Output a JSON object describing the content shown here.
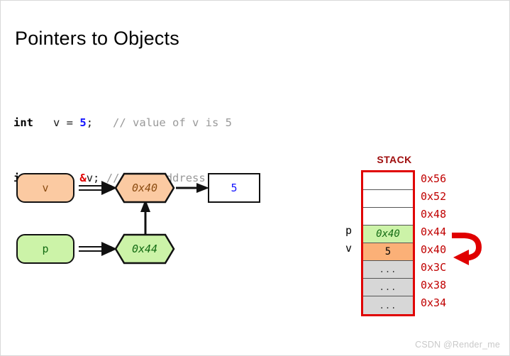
{
  "slide": {
    "title": "Pointers to Objects"
  },
  "code": {
    "lines": [
      {
        "keyword": "int",
        "star": "",
        "gap": "  ",
        "declaration": " v = ",
        "number": "5",
        "terminator": ";",
        "spacing": "   ",
        "comment": "// value of v is 5"
      },
      {
        "keyword": "int",
        "star": "*",
        "gap": " ",
        "declaration": " p = ",
        "number": "",
        "ampersand": "&",
        "target": "v",
        "terminator": ";",
        "spacing": " ",
        "comment": "// take address of v"
      }
    ]
  },
  "diagram": {
    "var_v_label": "v",
    "var_p_label": "p",
    "addr_v_label": "0x40",
    "addr_p_label": "0x44",
    "value_label": "5",
    "colors": {
      "orange_fill": "#fbcaa2",
      "orange_text": "#8a4b10",
      "green_fill": "#ccf3a8",
      "green_text": "#136b13",
      "value_text": "#1414ff",
      "stroke": "#111111"
    }
  },
  "stack": {
    "title": "STACK",
    "rows": [
      {
        "side": "",
        "value": "",
        "address": "0x56",
        "style": "empty"
      },
      {
        "side": "",
        "value": "",
        "address": "0x52",
        "style": "empty"
      },
      {
        "side": "",
        "value": "",
        "address": "0x48",
        "style": "empty"
      },
      {
        "side": "p",
        "value": "0x40",
        "address": "0x44",
        "style": "greenrow"
      },
      {
        "side": "v",
        "value": "5",
        "address": "0x40",
        "style": "orangerow"
      },
      {
        "side": "",
        "value": "...",
        "address": "0x3C",
        "style": "dots"
      },
      {
        "side": "",
        "value": "...",
        "address": "0x38",
        "style": "dots"
      },
      {
        "side": "",
        "value": "...",
        "address": "0x34",
        "style": "dots"
      }
    ],
    "colors": {
      "border": "#e00000",
      "title": "#9e0b0b",
      "address_text": "#c00000",
      "arrow": "#e00000"
    }
  },
  "watermark": {
    "text": "CSDN @Render_me"
  }
}
